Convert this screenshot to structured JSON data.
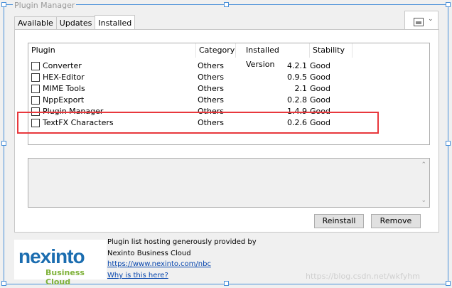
{
  "window": {
    "title": "Plugin Manager"
  },
  "tabs": [
    {
      "label": "Available"
    },
    {
      "label": "Updates"
    },
    {
      "label": "Installed"
    }
  ],
  "table": {
    "columns": [
      "Plugin",
      "Category",
      "Installed Version",
      "Stability"
    ],
    "rows": [
      {
        "name": "Converter",
        "category": "Others",
        "version": "4.2.1",
        "stability": "Good"
      },
      {
        "name": "HEX-Editor",
        "category": "Others",
        "version": "0.9.5",
        "stability": "Good"
      },
      {
        "name": "MIME Tools",
        "category": "Others",
        "version": "2.1",
        "stability": "Good"
      },
      {
        "name": "NppExport",
        "category": "Others",
        "version": "0.2.8",
        "stability": "Good"
      },
      {
        "name": "Plugin Manager",
        "category": "Others",
        "version": "1.4.9",
        "stability": "Good"
      },
      {
        "name": "TextFX Characters",
        "category": "Others",
        "version": "0.2.6",
        "stability": "Good"
      }
    ]
  },
  "buttons": {
    "reinstall": "Reinstall",
    "remove": "Remove"
  },
  "footer": {
    "logo_word": "nexinto",
    "logo_sub": "Business Cloud",
    "line1": "Plugin list hosting generously provided by",
    "line2": "Nexinto Business Cloud",
    "url": "https://www.nexinto.com/nbc",
    "why": "Why is this here?"
  },
  "watermark": "https://blog.csdn.net/wkfyhm",
  "colors": {
    "highlight": "#e8383d",
    "link": "#0645ad",
    "brand": "#1b6db0"
  }
}
